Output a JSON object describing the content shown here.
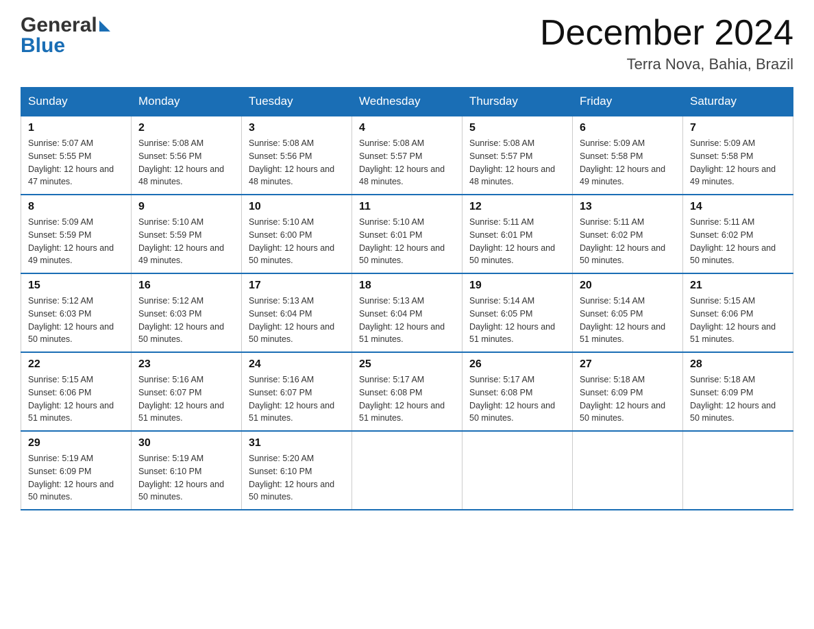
{
  "header": {
    "logo_text1": "General",
    "logo_text2": "Blue",
    "month_title": "December 2024",
    "location": "Terra Nova, Bahia, Brazil"
  },
  "days_of_week": [
    "Sunday",
    "Monday",
    "Tuesday",
    "Wednesday",
    "Thursday",
    "Friday",
    "Saturday"
  ],
  "weeks": [
    [
      {
        "day": "1",
        "sunrise": "5:07 AM",
        "sunset": "5:55 PM",
        "daylight": "12 hours and 47 minutes."
      },
      {
        "day": "2",
        "sunrise": "5:08 AM",
        "sunset": "5:56 PM",
        "daylight": "12 hours and 48 minutes."
      },
      {
        "day": "3",
        "sunrise": "5:08 AM",
        "sunset": "5:56 PM",
        "daylight": "12 hours and 48 minutes."
      },
      {
        "day": "4",
        "sunrise": "5:08 AM",
        "sunset": "5:57 PM",
        "daylight": "12 hours and 48 minutes."
      },
      {
        "day": "5",
        "sunrise": "5:08 AM",
        "sunset": "5:57 PM",
        "daylight": "12 hours and 48 minutes."
      },
      {
        "day": "6",
        "sunrise": "5:09 AM",
        "sunset": "5:58 PM",
        "daylight": "12 hours and 49 minutes."
      },
      {
        "day": "7",
        "sunrise": "5:09 AM",
        "sunset": "5:58 PM",
        "daylight": "12 hours and 49 minutes."
      }
    ],
    [
      {
        "day": "8",
        "sunrise": "5:09 AM",
        "sunset": "5:59 PM",
        "daylight": "12 hours and 49 minutes."
      },
      {
        "day": "9",
        "sunrise": "5:10 AM",
        "sunset": "5:59 PM",
        "daylight": "12 hours and 49 minutes."
      },
      {
        "day": "10",
        "sunrise": "5:10 AM",
        "sunset": "6:00 PM",
        "daylight": "12 hours and 50 minutes."
      },
      {
        "day": "11",
        "sunrise": "5:10 AM",
        "sunset": "6:01 PM",
        "daylight": "12 hours and 50 minutes."
      },
      {
        "day": "12",
        "sunrise": "5:11 AM",
        "sunset": "6:01 PM",
        "daylight": "12 hours and 50 minutes."
      },
      {
        "day": "13",
        "sunrise": "5:11 AM",
        "sunset": "6:02 PM",
        "daylight": "12 hours and 50 minutes."
      },
      {
        "day": "14",
        "sunrise": "5:11 AM",
        "sunset": "6:02 PM",
        "daylight": "12 hours and 50 minutes."
      }
    ],
    [
      {
        "day": "15",
        "sunrise": "5:12 AM",
        "sunset": "6:03 PM",
        "daylight": "12 hours and 50 minutes."
      },
      {
        "day": "16",
        "sunrise": "5:12 AM",
        "sunset": "6:03 PM",
        "daylight": "12 hours and 50 minutes."
      },
      {
        "day": "17",
        "sunrise": "5:13 AM",
        "sunset": "6:04 PM",
        "daylight": "12 hours and 50 minutes."
      },
      {
        "day": "18",
        "sunrise": "5:13 AM",
        "sunset": "6:04 PM",
        "daylight": "12 hours and 51 minutes."
      },
      {
        "day": "19",
        "sunrise": "5:14 AM",
        "sunset": "6:05 PM",
        "daylight": "12 hours and 51 minutes."
      },
      {
        "day": "20",
        "sunrise": "5:14 AM",
        "sunset": "6:05 PM",
        "daylight": "12 hours and 51 minutes."
      },
      {
        "day": "21",
        "sunrise": "5:15 AM",
        "sunset": "6:06 PM",
        "daylight": "12 hours and 51 minutes."
      }
    ],
    [
      {
        "day": "22",
        "sunrise": "5:15 AM",
        "sunset": "6:06 PM",
        "daylight": "12 hours and 51 minutes."
      },
      {
        "day": "23",
        "sunrise": "5:16 AM",
        "sunset": "6:07 PM",
        "daylight": "12 hours and 51 minutes."
      },
      {
        "day": "24",
        "sunrise": "5:16 AM",
        "sunset": "6:07 PM",
        "daylight": "12 hours and 51 minutes."
      },
      {
        "day": "25",
        "sunrise": "5:17 AM",
        "sunset": "6:08 PM",
        "daylight": "12 hours and 51 minutes."
      },
      {
        "day": "26",
        "sunrise": "5:17 AM",
        "sunset": "6:08 PM",
        "daylight": "12 hours and 50 minutes."
      },
      {
        "day": "27",
        "sunrise": "5:18 AM",
        "sunset": "6:09 PM",
        "daylight": "12 hours and 50 minutes."
      },
      {
        "day": "28",
        "sunrise": "5:18 AM",
        "sunset": "6:09 PM",
        "daylight": "12 hours and 50 minutes."
      }
    ],
    [
      {
        "day": "29",
        "sunrise": "5:19 AM",
        "sunset": "6:09 PM",
        "daylight": "12 hours and 50 minutes."
      },
      {
        "day": "30",
        "sunrise": "5:19 AM",
        "sunset": "6:10 PM",
        "daylight": "12 hours and 50 minutes."
      },
      {
        "day": "31",
        "sunrise": "5:20 AM",
        "sunset": "6:10 PM",
        "daylight": "12 hours and 50 minutes."
      },
      null,
      null,
      null,
      null
    ]
  ],
  "labels": {
    "sunrise": "Sunrise:",
    "sunset": "Sunset:",
    "daylight": "Daylight:"
  }
}
